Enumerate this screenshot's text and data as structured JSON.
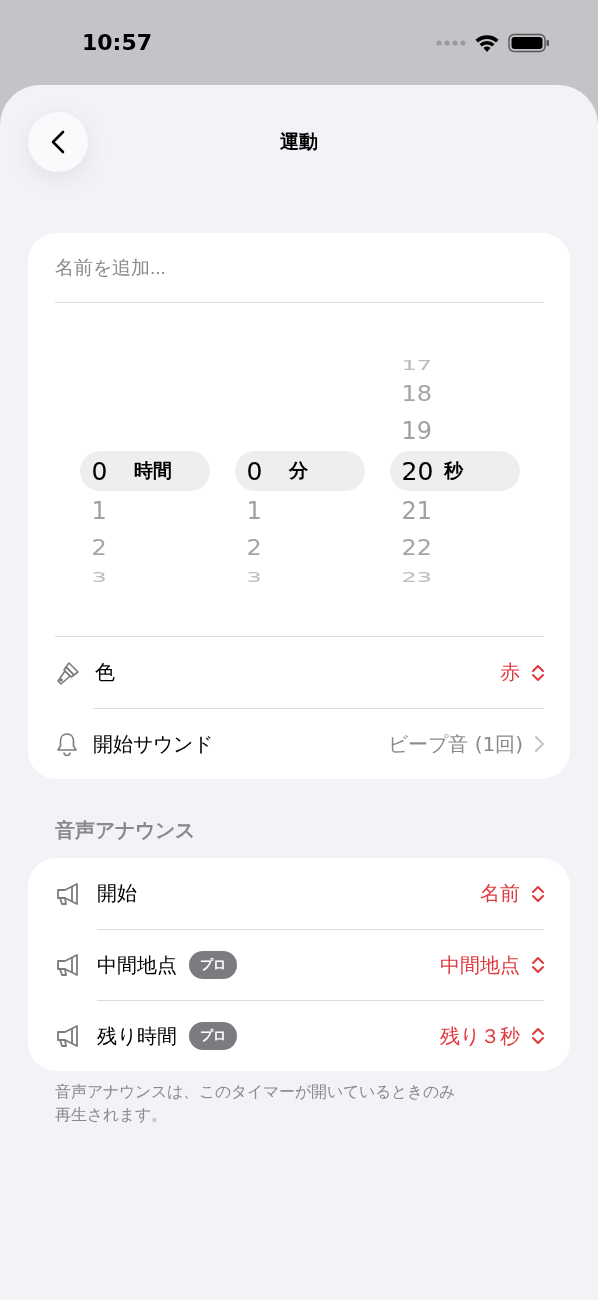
{
  "status_bar": {
    "time": "10:57"
  },
  "header": {
    "title": "運動"
  },
  "name_field": {
    "placeholder": "名前を追加..."
  },
  "picker": [
    {
      "value": "0",
      "unit": "時間",
      "below": [
        "1",
        "2",
        "3"
      ]
    },
    {
      "value": "0",
      "unit": "分",
      "below": [
        "1",
        "2",
        "3"
      ]
    },
    {
      "above": [
        "17",
        "18",
        "19"
      ],
      "value": "20",
      "unit": "秒",
      "below": [
        "21",
        "22",
        "23"
      ]
    }
  ],
  "settings": [
    {
      "kind": "color",
      "label": "色",
      "value": "赤"
    },
    {
      "kind": "sound",
      "label": "開始サウンド",
      "value": "ビープ音 (1回)"
    }
  ],
  "announcements": {
    "title": "音声アナウンス",
    "rows": [
      {
        "label": "開始",
        "value": "名前"
      },
      {
        "label": "中間地点",
        "badge": "プロ",
        "value": "中間地点"
      },
      {
        "label": "残り時間",
        "badge": "プロ",
        "value": "残り３秒"
      }
    ],
    "footer": "音声アナウンスは、このタイマーが開いているときのみ再生されます。"
  }
}
